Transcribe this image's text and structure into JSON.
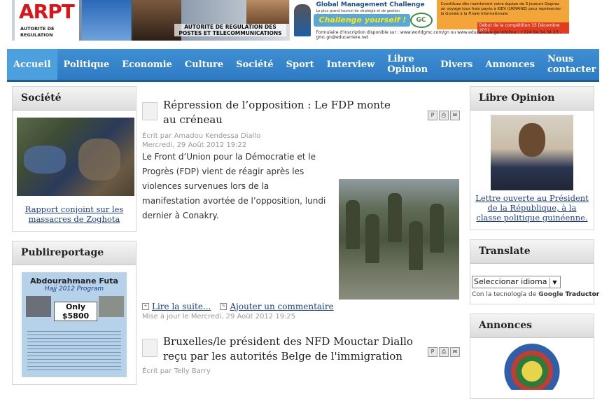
{
  "banner": {
    "arpt": {
      "logo_text": "ARPT",
      "logo_sub": "AUTORITE DE REGULATION",
      "caption": "AUTORITE DE REGULATION DES POSTES ET TELECOMMUNICATIONS"
    },
    "gmc": {
      "headline": "Global Management Challenge",
      "subline": "Le plus grand tournoi de stratégie et de gestion d'entreprise au monde",
      "slogan": "Challenge yourself !",
      "logo": "GC",
      "promo": "Constituez dès maintenant votre équipe de 3 joueurs Gagnez un voyage tous frais payés à KIEV (UKRAINE) pour représenter la Guinée à la Finale Internationale",
      "date": "Début de la compétition 15 Décembre 2011",
      "footer": "Formulaire d'inscription disponible sur : www.worldgmc.com/gn ou www.educarriere.ge   Infoline : +224 64 34 34 23 - gmc.gn@educarriere.net"
    }
  },
  "nav": {
    "items": [
      "Accueil",
      "Politique",
      "Economie",
      "Culture",
      "Société",
      "Sport",
      "Interview",
      "Libre Opinion",
      "Divers",
      "Annonces",
      "Nous contacter"
    ]
  },
  "left": {
    "societe": {
      "title": "Société",
      "link": "Rapport conjoint sur les massacres de Zoghota"
    },
    "publireportage": {
      "title": "Publireportage",
      "ad_title": "Abdourahmane Futa",
      "ad_sub": "Hajj 2012 Program",
      "ad_price": "Only $5800"
    }
  },
  "right": {
    "opinion": {
      "title": "Libre Opinion",
      "link": "Lettre ouverte au Président de la République, à la classe politique guinéenne."
    },
    "translate": {
      "title": "Translate",
      "select_value": "Seleccionar idioma",
      "note_prefix": "Con la tecnología de",
      "note_brand": "Google",
      "note_suffix": "Traductor de G"
    },
    "annonces": {
      "title": "Annonces"
    }
  },
  "articles": [
    {
      "title": "Répression de l’opposition : Le FDP monte au créneau",
      "author": "Écrit par Amadou Kendessa Diallo",
      "date": "Mercredi, 29 Août 2012 19:22",
      "para1": "Le Front d’Union pour la Démocratie et le Progrès (FDP) vient de réagir après les violences survenues lors de la",
      "para2": " manifestation avortée de l’opposition, lundi dernier à Conakry.",
      "read_more": "Lire la suite...",
      "comment": "Ajouter un commentaire",
      "updated": "Mise à jour le Mercredi, 29 Août 2012 19:25"
    },
    {
      "title": "Bruxelles/le président des NFD Mouctar Diallo reçu par les autorités Belge de l'immigration",
      "author": "Écrit par Telly Barry"
    }
  ]
}
